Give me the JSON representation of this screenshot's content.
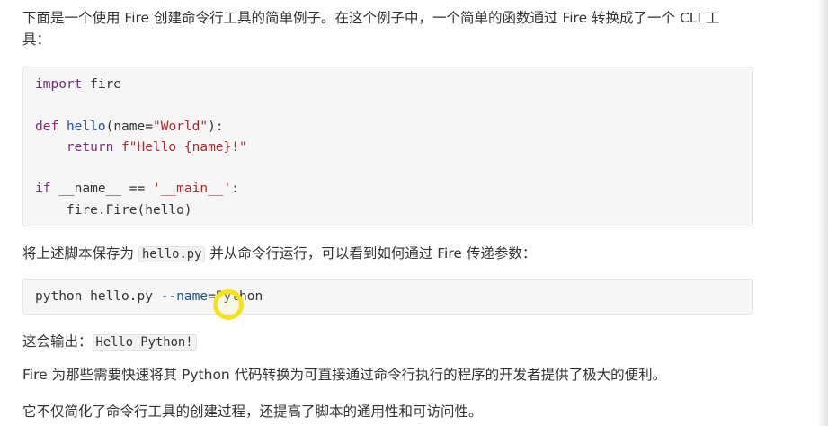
{
  "paragraphs": {
    "intro": "下面是一个使用 Fire 创建命令行工具的简单例子。在这个例子中，一个简单的函数通过 Fire 转换成了一个 CLI 工具：",
    "save_before": "将上述脚本保存为 ",
    "save_code": "hello.py",
    "save_after": " 并从命令行运行，可以看到如何通过 Fire 传递参数：",
    "output_label": "这会输出：",
    "output_code": "Hello Python!",
    "fire_desc": "Fire 为那些需要快速将其 Python 代码转换为可直接通过命令行执行的程序的开发者提供了极大的便利。",
    "summary": "它不仅简化了命令行工具的创建过程，还提高了脚本的通用性和可访问性。"
  },
  "code_block_1": {
    "l1_kw": "import",
    "l1_rest": " fire",
    "l3_kw": "def",
    "l3_fn": "hello",
    "l3_open": "(name=",
    "l3_str": "\"World\"",
    "l3_close": "):",
    "l4_indent": "    ",
    "l4_kw": "return",
    "l4_sp": " ",
    "l4_str": "f\"Hello {name}!\"",
    "l6_kw": "if",
    "l6_mid": " __name__ == ",
    "l6_str": "'__main__'",
    "l6_end": ":",
    "l7": "    fire.Fire(hello)"
  },
  "code_block_2": {
    "cmd": "python hello.py ",
    "flag": "--name",
    "eq": "=",
    "val": "Python"
  },
  "colors": {
    "keyword": "#7a2a7a",
    "function": "#2b4fb0",
    "string": "#a8282e",
    "cursor_highlight": "#f4e21f"
  }
}
